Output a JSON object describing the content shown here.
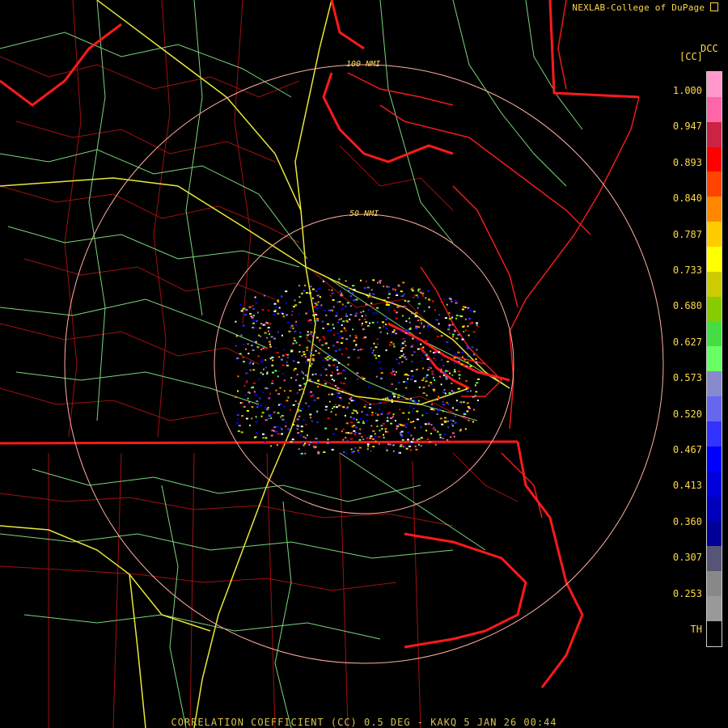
{
  "credit": "NEXLAB-College of DuPage",
  "credit_icon": "radar-logo-icon",
  "product": {
    "code": "DCC",
    "abbr": "[CC]"
  },
  "footer": "CORRELATION COEFFICIENT (CC) 0.5 DEG - KAKQ 5 JAN 26 00:44",
  "rings": [
    {
      "label": "100 NMI",
      "radius_nmi": 100
    },
    {
      "label": "50 NMI",
      "radius_nmi": 50
    }
  ],
  "legend": {
    "labels": [
      "1.000",
      "0.947",
      "0.893",
      "0.840",
      "0.787",
      "0.733",
      "0.680",
      "0.627",
      "0.573",
      "0.520",
      "0.467",
      "0.413",
      "0.360",
      "0.307",
      "0.253",
      "TH"
    ],
    "colors": [
      "#ff99cc",
      "#ff66aa",
      "#cc2244",
      "#ff0000",
      "#ff4400",
      "#ff8800",
      "#ffcc00",
      "#ffff00",
      "#cccc00",
      "#88cc00",
      "#44dd44",
      "#66ff66",
      "#8888cc",
      "#6666ee",
      "#3333ff",
      "#0000ff",
      "#0000dd",
      "#0000bb",
      "#000099",
      "#555577",
      "#888888",
      "#999999",
      "#000000"
    ]
  },
  "colors": {
    "state_border": "#ff0000",
    "county": "#b01010",
    "highway": "#ffff44",
    "road": "#88ff88",
    "ring": "#ffb0a0"
  }
}
